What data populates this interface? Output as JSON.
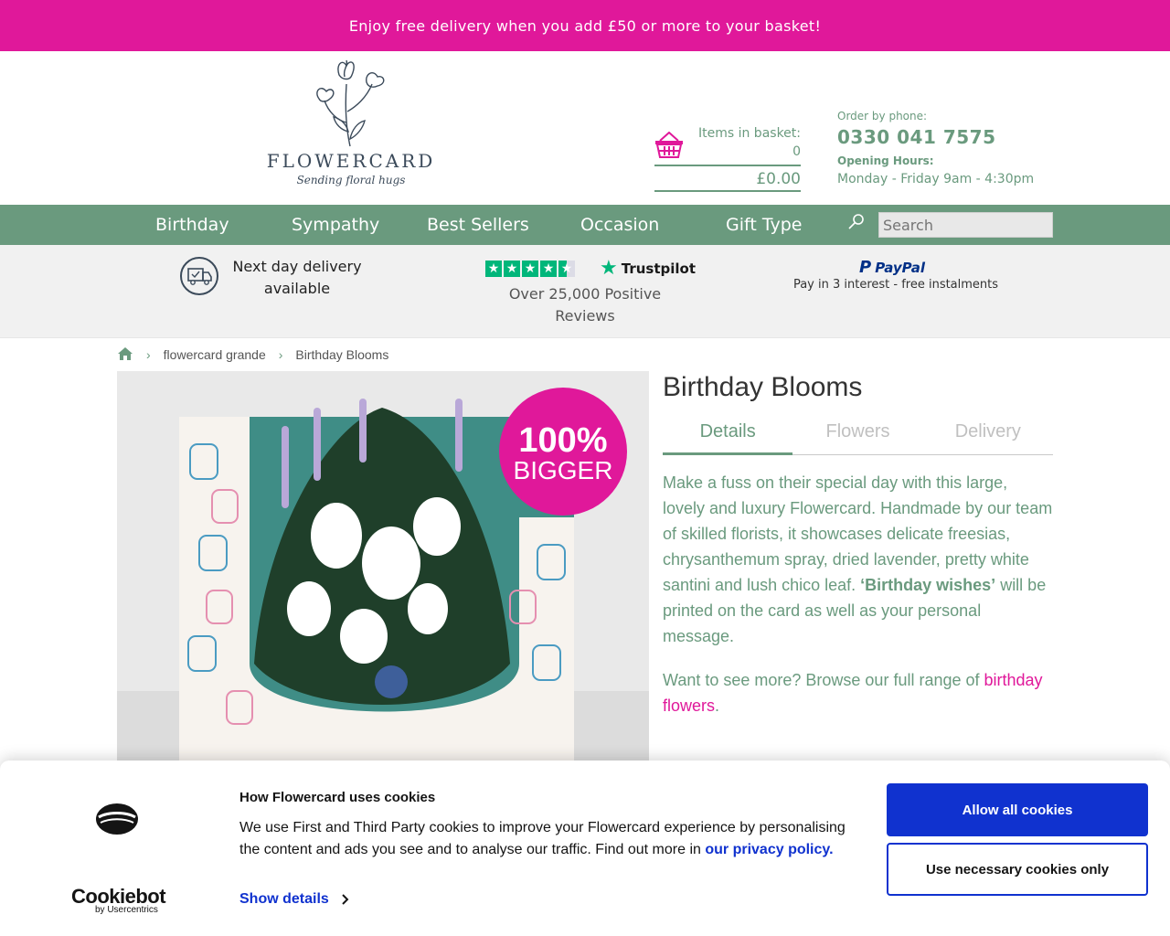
{
  "promo": {
    "text": "Enjoy free delivery when you add £50 or more to your basket!"
  },
  "logo": {
    "name": "FLOWERCARD",
    "tagline": "Sending floral hugs"
  },
  "basket": {
    "label": "Items in basket:",
    "count": "0",
    "total": "£0.00",
    "icon": "basket-icon"
  },
  "contact": {
    "order_label": "Order by phone:",
    "phone": "0330 041 7575",
    "hours_label": "Opening Hours:",
    "hours": "Monday - Friday 9am - 4:30pm"
  },
  "nav": {
    "items": [
      {
        "label": "Birthday"
      },
      {
        "label": "Sympathy"
      },
      {
        "label": "Best Sellers"
      },
      {
        "label": "Occasion"
      },
      {
        "label": "Gift Type"
      }
    ],
    "search_placeholder": "Search"
  },
  "usp": {
    "delivery_text": "Next day delivery available",
    "trustpilot_name": "Trustpilot",
    "trustpilot_rating": 4.5,
    "reviews_text": "Over 25,000 Positive Reviews",
    "paypal_name": "PayPal",
    "paypal_text": "Pay in 3 interest - free instalments"
  },
  "breadcrumb": {
    "items": [
      "flowercard grande",
      "Birthday Blooms"
    ]
  },
  "product": {
    "badge": [
      "100%",
      "BIGGER"
    ],
    "title": "Birthday Blooms",
    "tabs": [
      {
        "label": "Details",
        "active": true
      },
      {
        "label": "Flowers",
        "active": false
      },
      {
        "label": "Delivery",
        "active": false
      }
    ],
    "description_before": "Make a fuss on their special day with this large, lovely and luxury Flowercard. Handmade by our team of skilled florists, it showcases delicate freesias, chrysanthemum spray, dried lavender, pretty white santini and lush chico leaf. ",
    "description_bold": "‘Birthday wishes’",
    "description_after": " will be printed on the card as well as your personal message.",
    "more_before": "Want to see more? Browse our full range of ",
    "more_link": "birthday flowers",
    "more_after": "."
  },
  "cookies": {
    "brand": "Cookiebot",
    "brand_sub": "by Usercentrics",
    "title": "How Flowercard uses cookies",
    "text": "We use First and Third Party cookies to improve your Flowercard experience by personalising the content and ads you see and to analyse our traffic. Find out more in ",
    "link": "our privacy policy.",
    "show_details": "Show details",
    "allow_all": "Allow all cookies",
    "necessary_only": "Use necessary cookies only"
  },
  "colors": {
    "brand_pink": "#e0189a",
    "brand_green": "#6a9a7e",
    "cookie_blue": "#1032cf",
    "trustpilot_green": "#00b67a"
  }
}
